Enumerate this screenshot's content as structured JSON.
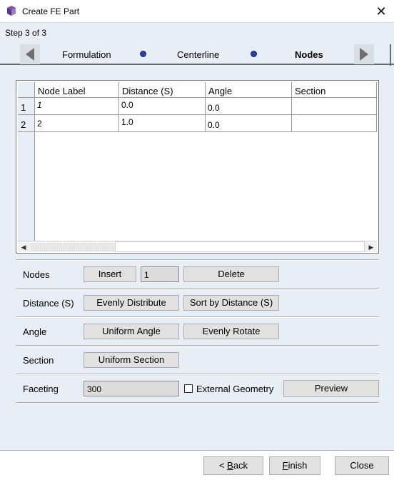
{
  "window": {
    "title": "Create FE Part",
    "close_glyph": "✕"
  },
  "wizard": {
    "step_text": "Step 3 of 3",
    "steps": [
      "Formulation",
      "Centerline",
      "Nodes"
    ],
    "active_step": "Nodes"
  },
  "table": {
    "columns": [
      "Node Label",
      "Distance (S)",
      "Angle",
      "Section"
    ],
    "rows": [
      {
        "num": "1",
        "cells": [
          "1",
          "0.0",
          "0.0",
          ""
        ]
      },
      {
        "num": "2",
        "cells": [
          "2",
          "1.0",
          "0.0",
          ""
        ]
      }
    ]
  },
  "controls": {
    "nodes": {
      "label": "Nodes",
      "insert": "Insert",
      "count_value": "1",
      "delete": "Delete"
    },
    "distance": {
      "label": "Distance (S)",
      "evenly": "Evenly Distribute",
      "sort": "Sort by Distance (S)"
    },
    "angle": {
      "label": "Angle",
      "uniform": "Uniform Angle",
      "rotate": "Evenly Rotate"
    },
    "section": {
      "label": "Section",
      "uniform": "Uniform Section"
    },
    "faceting": {
      "label": "Faceting",
      "value": "300",
      "external_label": "External Geometry",
      "external_checked": false,
      "preview": "Preview"
    }
  },
  "footer": {
    "back": {
      "prefix": "< ",
      "mnemonic": "B",
      "rest": "ack"
    },
    "finish": {
      "mnemonic": "F",
      "rest": "inish"
    },
    "close": "Close"
  },
  "colors": {
    "dialog_bg": "#e7eef6",
    "step_dot": "#2c3fa8",
    "button_bg": "#e1e1e1"
  }
}
